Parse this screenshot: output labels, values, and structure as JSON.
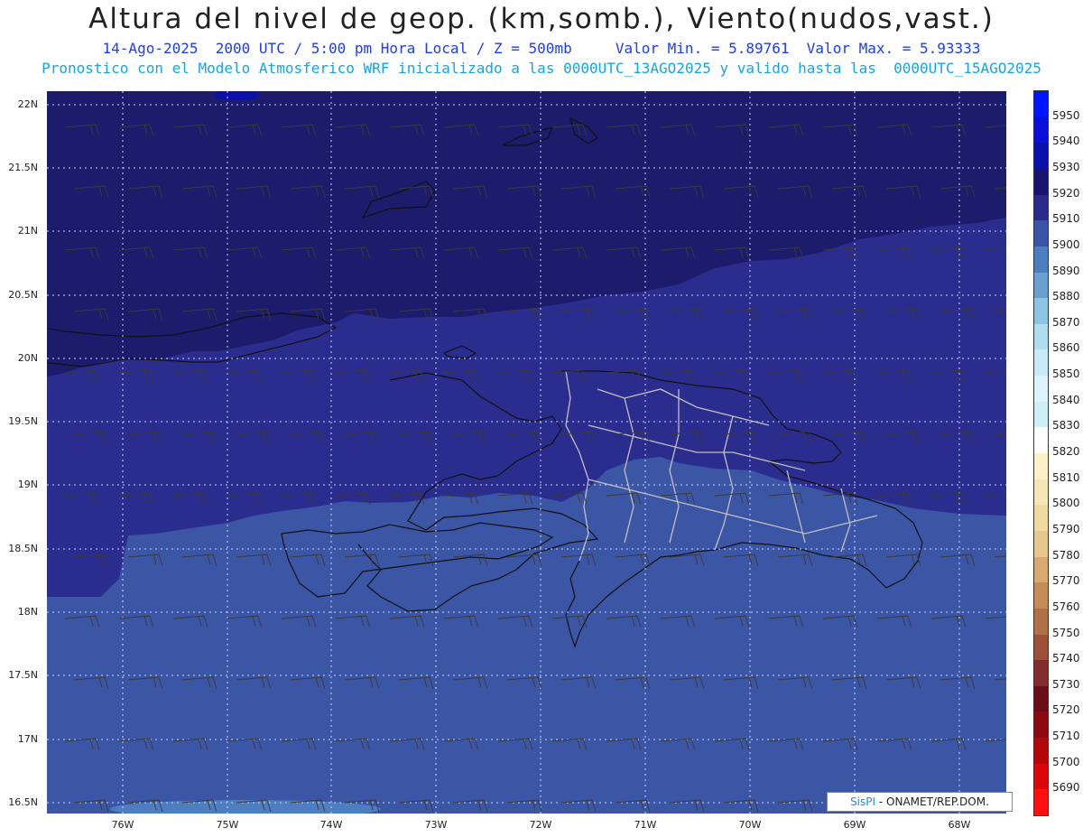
{
  "header": {
    "title": "Altura del nivel de geop. (km,somb.), Viento(nudos,vast.)",
    "subtitle1": "14-Ago-2025  2000 UTC / 5:00 pm Hora Local / Z = 500mb     Valor Min. = 5.89761  Valor Max. = 5.93333",
    "subtitle2": "Pronostico con el Modelo Atmosferico WRF inicializado a las 0000UTC_13AGO2025 y valido hasta las  0000UTC_15AGO2025"
  },
  "axes": {
    "lat_labels": [
      "22N",
      "21.5N",
      "21N",
      "20.5N",
      "20N",
      "19.5N",
      "19N",
      "18.5N",
      "18N",
      "17.5N",
      "17N",
      "16.5N"
    ],
    "lon_labels": [
      "76W",
      "75W",
      "74W",
      "73W",
      "72W",
      "71W",
      "70W",
      "69W",
      "68W"
    ]
  },
  "legend": {
    "levels": [
      "5950",
      "5940",
      "5930",
      "5920",
      "5910",
      "5900",
      "5890",
      "5880",
      "5870",
      "5860",
      "5850",
      "5840",
      "5830",
      "5820",
      "5810",
      "5800",
      "5790",
      "5780",
      "5770",
      "5760",
      "5750",
      "5740",
      "5730",
      "5720",
      "5710",
      "5700",
      "5690"
    ],
    "colors": [
      "#0015ff",
      "#0810d8",
      "#0b0fab",
      "#191470",
      "#292a8a",
      "#3b55a6",
      "#4d7ec0",
      "#6a9fd0",
      "#8ec3e2",
      "#b1dcef",
      "#c8eaf6",
      "#dff3fb",
      "#cdf0f7",
      "#ffffff",
      "#fbf0c8",
      "#f5e6b5",
      "#efdba2",
      "#e6c78d",
      "#d8aa72",
      "#c58c58",
      "#b07048",
      "#9c5238",
      "#822e2e",
      "#6a0f1a",
      "#8d0a10",
      "#b40808",
      "#dd0606",
      "#ff1010"
    ]
  },
  "colors": {
    "field_high": "#1c1b6c",
    "field_mid": "#2b2d8e",
    "field_low": "#3b56a5",
    "coastline": "#111111",
    "province_border": "#bbbbbb"
  },
  "credit": {
    "brand": "SisPI",
    "org": "- ONAMET/REP.DOM."
  }
}
